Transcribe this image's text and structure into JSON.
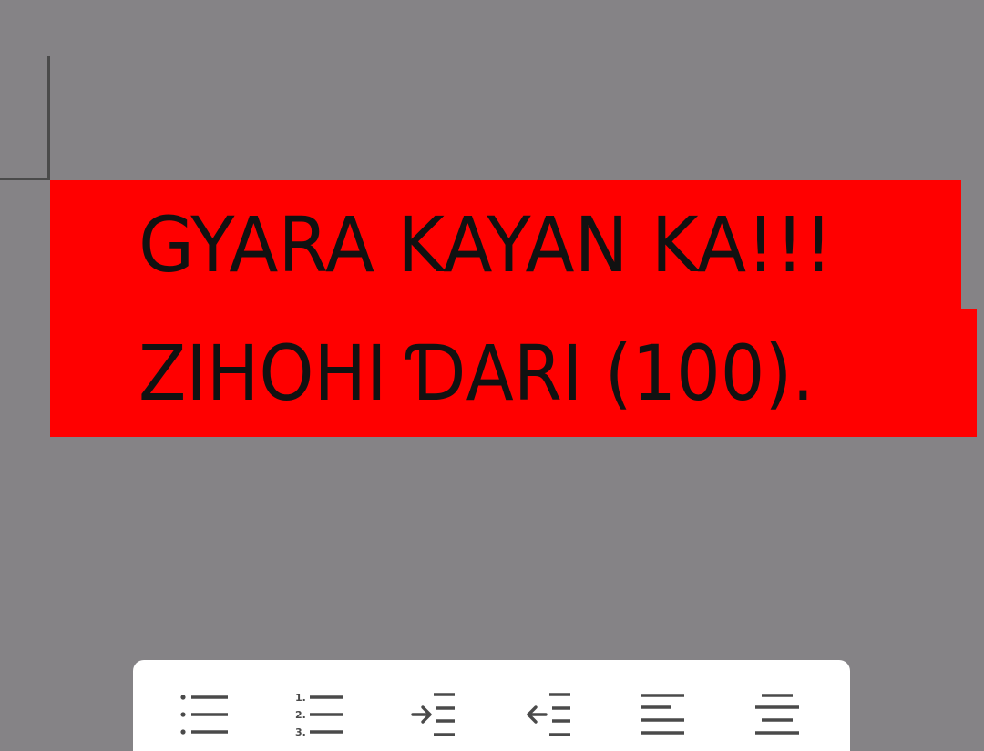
{
  "document": {
    "lines": [
      "GYARA KAYAN KA!!!",
      "ZIHOHI ƊARI (100)."
    ],
    "highlight_color": "#ff0000",
    "text_color": "#111111",
    "background_color": "#858386"
  },
  "toolbar": {
    "numbered_list_markers": [
      "1.",
      "2.",
      "3."
    ],
    "buttons": [
      {
        "icon": "bulleted-list-icon"
      },
      {
        "icon": "numbered-list-icon"
      },
      {
        "icon": "increase-indent-icon"
      },
      {
        "icon": "decrease-indent-icon"
      },
      {
        "icon": "align-left-icon"
      },
      {
        "icon": "align-center-icon"
      }
    ]
  }
}
